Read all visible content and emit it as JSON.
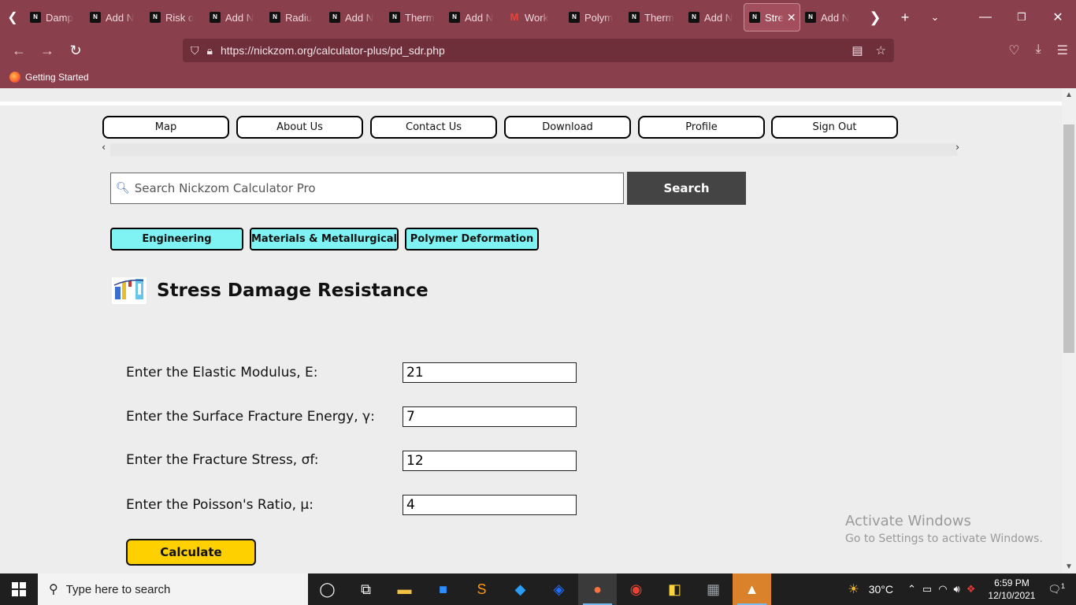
{
  "browser": {
    "tabs": [
      {
        "title": "Damp",
        "fav": "nickzom"
      },
      {
        "title": "Add N",
        "fav": "nickzom"
      },
      {
        "title": "Risk o",
        "fav": "nickzom"
      },
      {
        "title": "Add N",
        "fav": "nickzom"
      },
      {
        "title": "Radiu",
        "fav": "nickzom"
      },
      {
        "title": "Add N",
        "fav": "nickzom"
      },
      {
        "title": "Therm",
        "fav": "nickzom"
      },
      {
        "title": "Add N",
        "fav": "nickzom"
      },
      {
        "title": "Work",
        "fav": "gmail"
      },
      {
        "title": "Polym",
        "fav": "nickzom"
      },
      {
        "title": "Therm",
        "fav": "nickzom"
      },
      {
        "title": "Add N",
        "fav": "nickzom"
      },
      {
        "title": "Stre",
        "fav": "nickzom",
        "active": true
      },
      {
        "title": "Add N",
        "fav": "nickzom"
      }
    ],
    "url": "https://nickzom.org/calculator-plus/pd_sdr.php",
    "bookmark": "Getting Started"
  },
  "menu": {
    "items": [
      "Map",
      "About Us",
      "Contact Us",
      "Download",
      "Profile",
      "Sign Out"
    ],
    "left_arrow": "‹",
    "right_arrow": "›"
  },
  "search": {
    "placeholder": "Search Nickzom Calculator Pro",
    "button": "Search"
  },
  "categories": [
    "Engineering",
    "Materials & Metallurgical",
    "Polymer Deformation"
  ],
  "page": {
    "title": "Stress Damage Resistance"
  },
  "fields": [
    {
      "label": "Enter the Elastic Modulus, E:",
      "value": "21"
    },
    {
      "label": "Enter the Surface Fracture Energy, γ:",
      "value": "7"
    },
    {
      "label": "Enter the Fracture Stress, σf:",
      "value": "12"
    },
    {
      "label": "Enter the Poisson's Ratio, μ:",
      "value": "4"
    }
  ],
  "calculate_label": "Calculate",
  "watermark": {
    "line1": "Activate Windows",
    "line2": "Go to Settings to activate Windows."
  },
  "taskbar": {
    "search_placeholder": "Type here to search",
    "temperature": "30°C",
    "time": "6:59 PM",
    "date": "12/10/2021",
    "notifications": "1"
  }
}
